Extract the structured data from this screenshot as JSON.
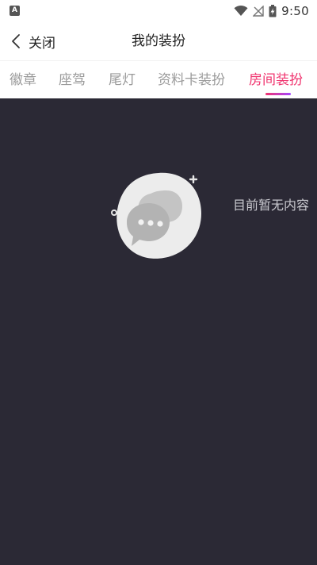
{
  "status_bar": {
    "app_icon_letter": "A",
    "time": "9:50"
  },
  "header": {
    "back_label": "关闭",
    "title": "我的装扮"
  },
  "tabs": [
    {
      "label": "徽章",
      "active": false
    },
    {
      "label": "座驾",
      "active": false
    },
    {
      "label": "尾灯",
      "active": false
    },
    {
      "label": "资料卡装扮",
      "active": false
    },
    {
      "label": "房间装扮",
      "active": true
    }
  ],
  "content": {
    "empty_message": "目前暂无内容"
  },
  "colors": {
    "accent": "#f0336e",
    "accent_gradient_end": "#a445ff",
    "content_background": "#2b2935",
    "tab_inactive": "#9a9a9a"
  }
}
